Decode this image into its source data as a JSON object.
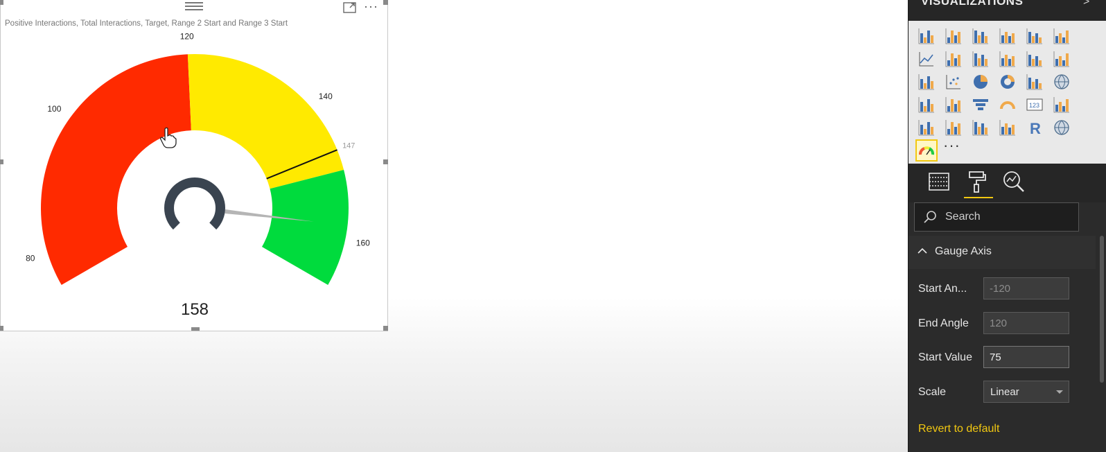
{
  "visual": {
    "title": "Positive Interactions, Total Interactions, Target, Range 2 Start and Range 3 Start",
    "more_label": "···"
  },
  "chart_data": {
    "type": "gauge",
    "start_angle": -120,
    "end_angle": 120,
    "min": 75,
    "max": 167,
    "value": 158,
    "target": 147,
    "ticks": [
      80,
      100,
      120,
      140,
      160
    ],
    "ranges": [
      {
        "from": 75,
        "to": 120,
        "color": "#ff2a00"
      },
      {
        "from": 120,
        "to": 150,
        "color": "#ffea00"
      },
      {
        "from": 150,
        "to": 167,
        "color": "#00db3d"
      }
    ],
    "value_label": "158",
    "target_label": "147"
  },
  "pane": {
    "title": "VISUALIZATIONS",
    "chevron": ">",
    "more_label": "···",
    "search_placeholder": "Search",
    "section_title": "Gauge Axis",
    "properties": {
      "start_angle": {
        "label": "Start An...",
        "value": "-120"
      },
      "end_angle": {
        "label": "End Angle",
        "value": "120"
      },
      "start_value": {
        "label": "Start Value",
        "value": "75"
      },
      "scale": {
        "label": "Scale",
        "value": "Linear"
      }
    },
    "revert_label": "Revert to default",
    "accent_color": "#f2c811"
  },
  "viz_icons": [
    "stacked-bar-icon",
    "stacked-column-icon",
    "clustered-bar-icon",
    "clustered-column-icon",
    "100-stacked-bar-icon",
    "100-stacked-column-icon",
    "line-chart-icon",
    "area-chart-icon",
    "stacked-area-icon",
    "line-column-icon",
    "line-clustered-column-icon",
    "ribbon-chart-icon",
    "waterfall-icon",
    "scatter-icon",
    "pie-icon",
    "donut-icon",
    "treemap-icon",
    "map-icon",
    "filled-map-icon",
    "shape-map-icon",
    "funnel-icon",
    "gauge-icon",
    "card-icon",
    "multirow-card-icon",
    "kpi-icon",
    "slicer-icon",
    "table-icon",
    "matrix-icon",
    "r-visual-icon",
    "globe-icon",
    "custom-gauge-icon"
  ]
}
